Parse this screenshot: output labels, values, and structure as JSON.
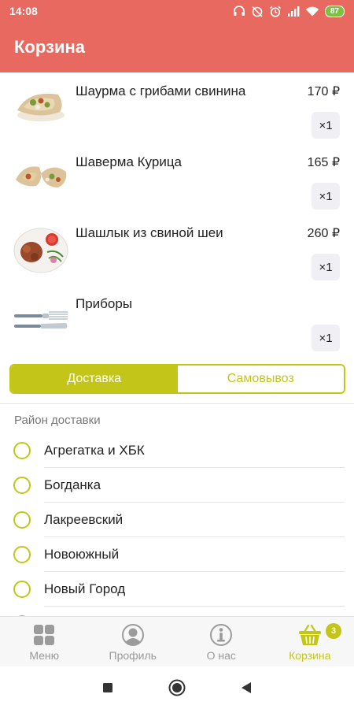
{
  "status_bar": {
    "time": "14:08",
    "battery": "87",
    "icons": [
      "headset-icon",
      "alarm-off-icon",
      "alarm-icon",
      "signal-icon",
      "wifi-icon",
      "battery-icon"
    ]
  },
  "app_bar": {
    "title": "Корзина"
  },
  "cart": {
    "items": [
      {
        "name": "Шаурма с грибами свинина",
        "price": "170 ₽",
        "qty": "×1",
        "image": "shawarma-mushroom-image"
      },
      {
        "name": "Шаверма Курица",
        "price": "165 ₽",
        "qty": "×1",
        "image": "shawarma-chicken-image"
      },
      {
        "name": "Шашлык из свиной шеи",
        "price": "260 ₽",
        "qty": "×1",
        "image": "shashlik-image"
      },
      {
        "name": "Приборы",
        "price": "",
        "qty": "×1",
        "image": "cutlery-image"
      }
    ]
  },
  "delivery_toggle": {
    "delivery": "Доставка",
    "pickup": "Самовывоз",
    "selected": "delivery"
  },
  "district": {
    "section_label": "Район доставки",
    "options": [
      "Агрегатка и ХБК",
      "Богданка",
      "Лакреевский",
      "Новоюжный",
      "Новый Город"
    ]
  },
  "bottom_nav": {
    "items": [
      {
        "label": "Меню",
        "icon": "grid-icon"
      },
      {
        "label": "Профиль",
        "icon": "profile-icon"
      },
      {
        "label": "О нас",
        "icon": "info-icon"
      },
      {
        "label": "Корзина",
        "icon": "basket-icon",
        "badge": "3",
        "active": true
      }
    ]
  },
  "colors": {
    "header": "#e8695f",
    "accent": "#c3c619",
    "battery": "#7cc242"
  }
}
